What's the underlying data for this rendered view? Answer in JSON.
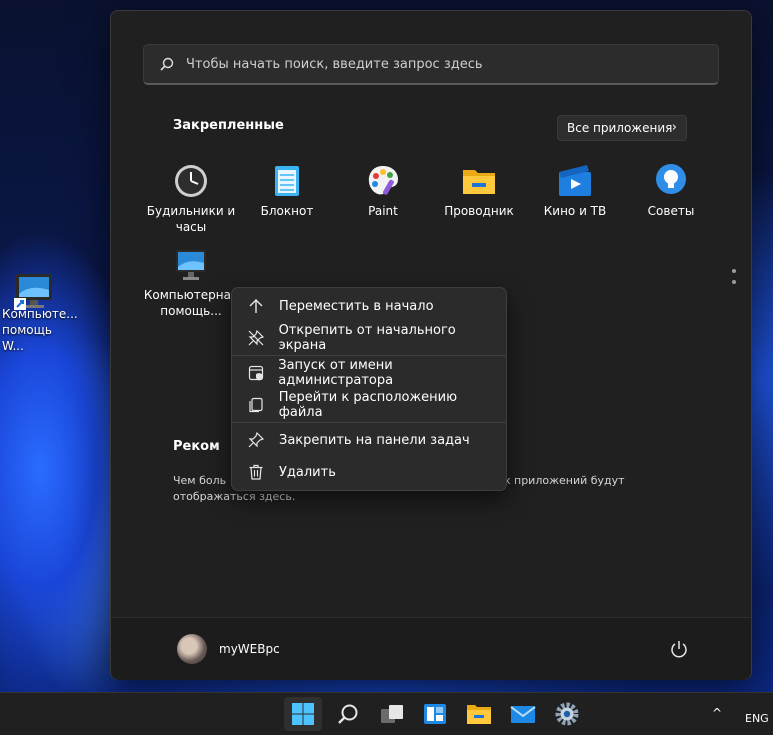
{
  "desktop": {
    "icon_label_line1": "Компьюте...",
    "icon_label_line2": "помощь W..."
  },
  "start_menu": {
    "search_placeholder": "Чтобы начать поиск, введите запрос здесь",
    "pinned_title": "Закрепленные",
    "all_apps_label": "Все приложения",
    "pinned_apps": [
      {
        "label": "Будильники и часы",
        "icon": "alarm-clock-icon"
      },
      {
        "label": "Блокнот",
        "icon": "notepad-icon"
      },
      {
        "label": "Paint",
        "icon": "paint-palette-icon"
      },
      {
        "label": "Проводник",
        "icon": "file-explorer-folder-icon"
      },
      {
        "label": "Кино и ТВ",
        "icon": "movies-tv-icon"
      },
      {
        "label": "Советы",
        "icon": "tips-lightbulb-icon"
      },
      {
        "label": "Компьютерная помощь...",
        "icon": "computer-monitor-icon"
      }
    ],
    "recommended_title": "Реком",
    "recommended_text_left": "Чем боль",
    "recommended_text_right": "х приложений будут",
    "recommended_text_line2": "отображаться здесь.",
    "user_name": "myWEBpc"
  },
  "context_menu": {
    "items": [
      {
        "label": "Переместить в начало",
        "icon": "arrow-up-icon"
      },
      {
        "label": "Открепить от начального экрана",
        "icon": "unpin-icon"
      },
      {
        "label": "Запуск от имени администратора",
        "icon": "shield-run-as-admin-icon"
      },
      {
        "label": "Перейти к расположению файла",
        "icon": "open-file-location-icon"
      },
      {
        "label": "Закрепить на панели задач",
        "icon": "pin-icon"
      },
      {
        "label": "Удалить",
        "icon": "trash-icon"
      }
    ]
  },
  "taskbar": {
    "language": "ENG",
    "tray_chevron": "^"
  },
  "colors": {
    "accent": "#0078d4",
    "menu_bg": "#202020",
    "context_bg": "#2b2b2b"
  }
}
